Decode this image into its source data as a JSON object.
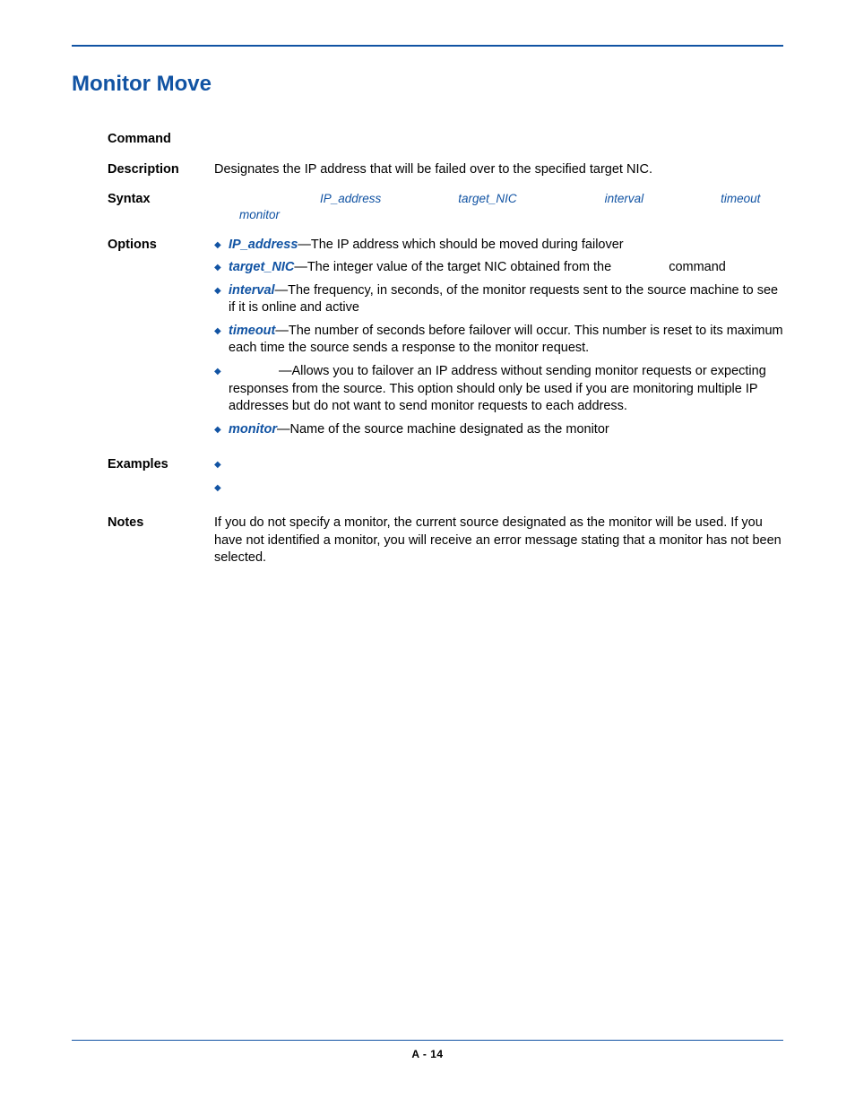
{
  "title": "Monitor Move",
  "labels": {
    "command": "Command",
    "description": "Description",
    "syntax": "Syntax",
    "options": "Options",
    "examples": "Examples",
    "notes": "Notes"
  },
  "description_text": "Designates the IP address that will be failed over to the specified target NIC.",
  "syntax": {
    "p1": "IP_address",
    "p2": "target_NIC",
    "p3": "interval",
    "p4": "timeout",
    "line2": "monitor"
  },
  "options": [
    {
      "key": "IP_address",
      "sep": "—",
      "text_a": "The IP address which should be moved during failover",
      "text_b": ""
    },
    {
      "key": "target_NIC",
      "sep": "—",
      "text_a": "The integer value of the target NIC obtained from the ",
      "trailing_plain": "command",
      "gap_before_trailing": 60
    },
    {
      "key": "interval",
      "sep": "—",
      "text_a": "The frequency, in seconds, of the monitor requests sent to the source machine to see if it is online and active"
    },
    {
      "key": "timeout",
      "sep": "—",
      "text_a": "The number of seconds before failover will occur. This number is reset to its maximum each time the source sends a response to the monitor request."
    },
    {
      "key": "",
      "sep": "",
      "lead_gap": 56,
      "text_a": "—Allows you to failover an IP address without sending monitor requests or expecting responses from the source. This option should only be used if you are monitoring multiple IP addresses but do not want to send monitor requests to each address."
    },
    {
      "key": "monitor",
      "sep": "—",
      "text_a": "Name of the source machine designated as the monitor"
    }
  ],
  "examples_count": 2,
  "notes_text": "If you do not specify a monitor, the current source designated as the monitor will be used. If you have not identified a monitor, you will receive an error message stating that a monitor has not been selected.",
  "footer_page": "A - 14"
}
